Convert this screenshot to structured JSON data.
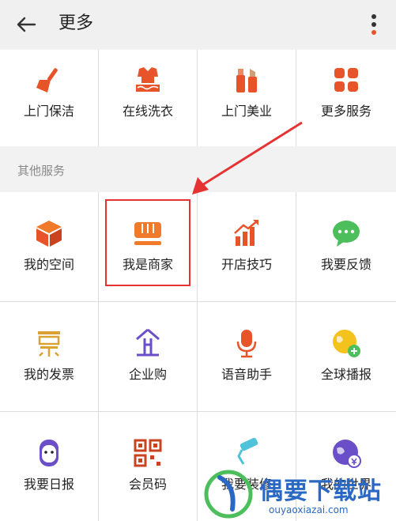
{
  "header": {
    "title": "更多",
    "back_icon": "arrow-left-icon",
    "menu_icon": "more-vertical-icon"
  },
  "top_services": [
    {
      "label": "上门保洁",
      "icon": "broom-icon"
    },
    {
      "label": "在线洗衣",
      "icon": "laundry-icon"
    },
    {
      "label": "上门美业",
      "icon": "cosmetics-icon"
    },
    {
      "label": "更多服务",
      "icon": "grid-icon"
    }
  ],
  "section": {
    "title": "其他服务"
  },
  "other_services": [
    {
      "label": "我的空间",
      "icon": "box-icon"
    },
    {
      "label": "我是商家",
      "icon": "store-icon"
    },
    {
      "label": "开店技巧",
      "icon": "growth-chart-icon"
    },
    {
      "label": "我要反馈",
      "icon": "chat-bubble-icon"
    },
    {
      "label": "我的发票",
      "icon": "invoice-icon"
    },
    {
      "label": "企业购",
      "icon": "enterprise-icon"
    },
    {
      "label": "语音助手",
      "icon": "microphone-icon"
    },
    {
      "label": "全球播报",
      "icon": "globe-broadcast-icon"
    },
    {
      "label": "我要日报",
      "icon": "daily-report-icon"
    },
    {
      "label": "会员码",
      "icon": "qr-code-icon"
    },
    {
      "label": "我要装修",
      "icon": "paint-roller-icon"
    },
    {
      "label": "我的世界",
      "icon": "world-icon"
    }
  ],
  "colors": {
    "accent": "#e8542a",
    "orange": "#f07a2a",
    "green": "#4cbf5c",
    "purple": "#6b4fc8",
    "highlight": "#e53333"
  },
  "watermark": {
    "title": "偶要下载站",
    "url": "ouyaoxiazai.com"
  }
}
